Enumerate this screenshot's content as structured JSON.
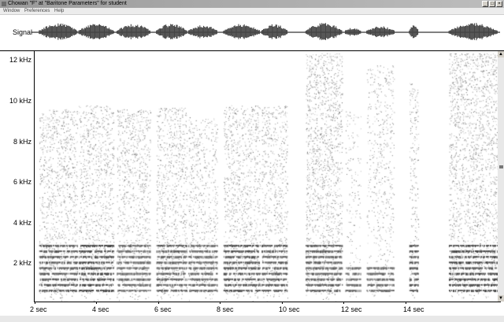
{
  "window": {
    "title": "Chowan \"F\" at \"Baritone Parameters\" for student",
    "menu": [
      "Window",
      "Preferences",
      "Help"
    ]
  },
  "signal": {
    "label": "Signal"
  },
  "spectrogram": {
    "y_labels": [
      "12 kHz",
      "10 kHz",
      "8 kHz",
      "6 kHz",
      "4 kHz",
      "2 kHz"
    ],
    "x_labels": [
      "2  sec",
      "4  sec",
      "6  sec",
      "8  sec",
      "10  sec",
      "12  sec",
      "14  sec"
    ],
    "x_range_sec": [
      1.9,
      17.1
    ],
    "y_range_khz": [
      0,
      12.5
    ],
    "segments": [
      {
        "start": 2.05,
        "end": 3.3,
        "top_khz": 9.6,
        "energy": 0.9
      },
      {
        "start": 3.35,
        "end": 4.5,
        "top_khz": 9.8,
        "energy": 0.85
      },
      {
        "start": 4.6,
        "end": 5.7,
        "top_khz": 9.6,
        "energy": 0.85
      },
      {
        "start": 5.9,
        "end": 6.9,
        "top_khz": 9.7,
        "energy": 0.9
      },
      {
        "start": 6.95,
        "end": 7.9,
        "top_khz": 9.2,
        "energy": 0.7
      },
      {
        "start": 8.1,
        "end": 9.3,
        "top_khz": 9.8,
        "energy": 0.85
      },
      {
        "start": 9.35,
        "end": 10.2,
        "top_khz": 9.8,
        "energy": 0.8
      },
      {
        "start": 10.8,
        "end": 12.0,
        "top_khz": 12.4,
        "energy": 1.0
      },
      {
        "start": 12.1,
        "end": 12.6,
        "top_khz": 9.5,
        "energy": 0.35
      },
      {
        "start": 12.8,
        "end": 13.7,
        "top_khz": 11.8,
        "energy": 0.55
      },
      {
        "start": 14.2,
        "end": 14.5,
        "top_khz": 11.0,
        "energy": 0.7
      },
      {
        "start": 15.5,
        "end": 17.1,
        "top_khz": 12.4,
        "energy": 1.0
      }
    ]
  }
}
